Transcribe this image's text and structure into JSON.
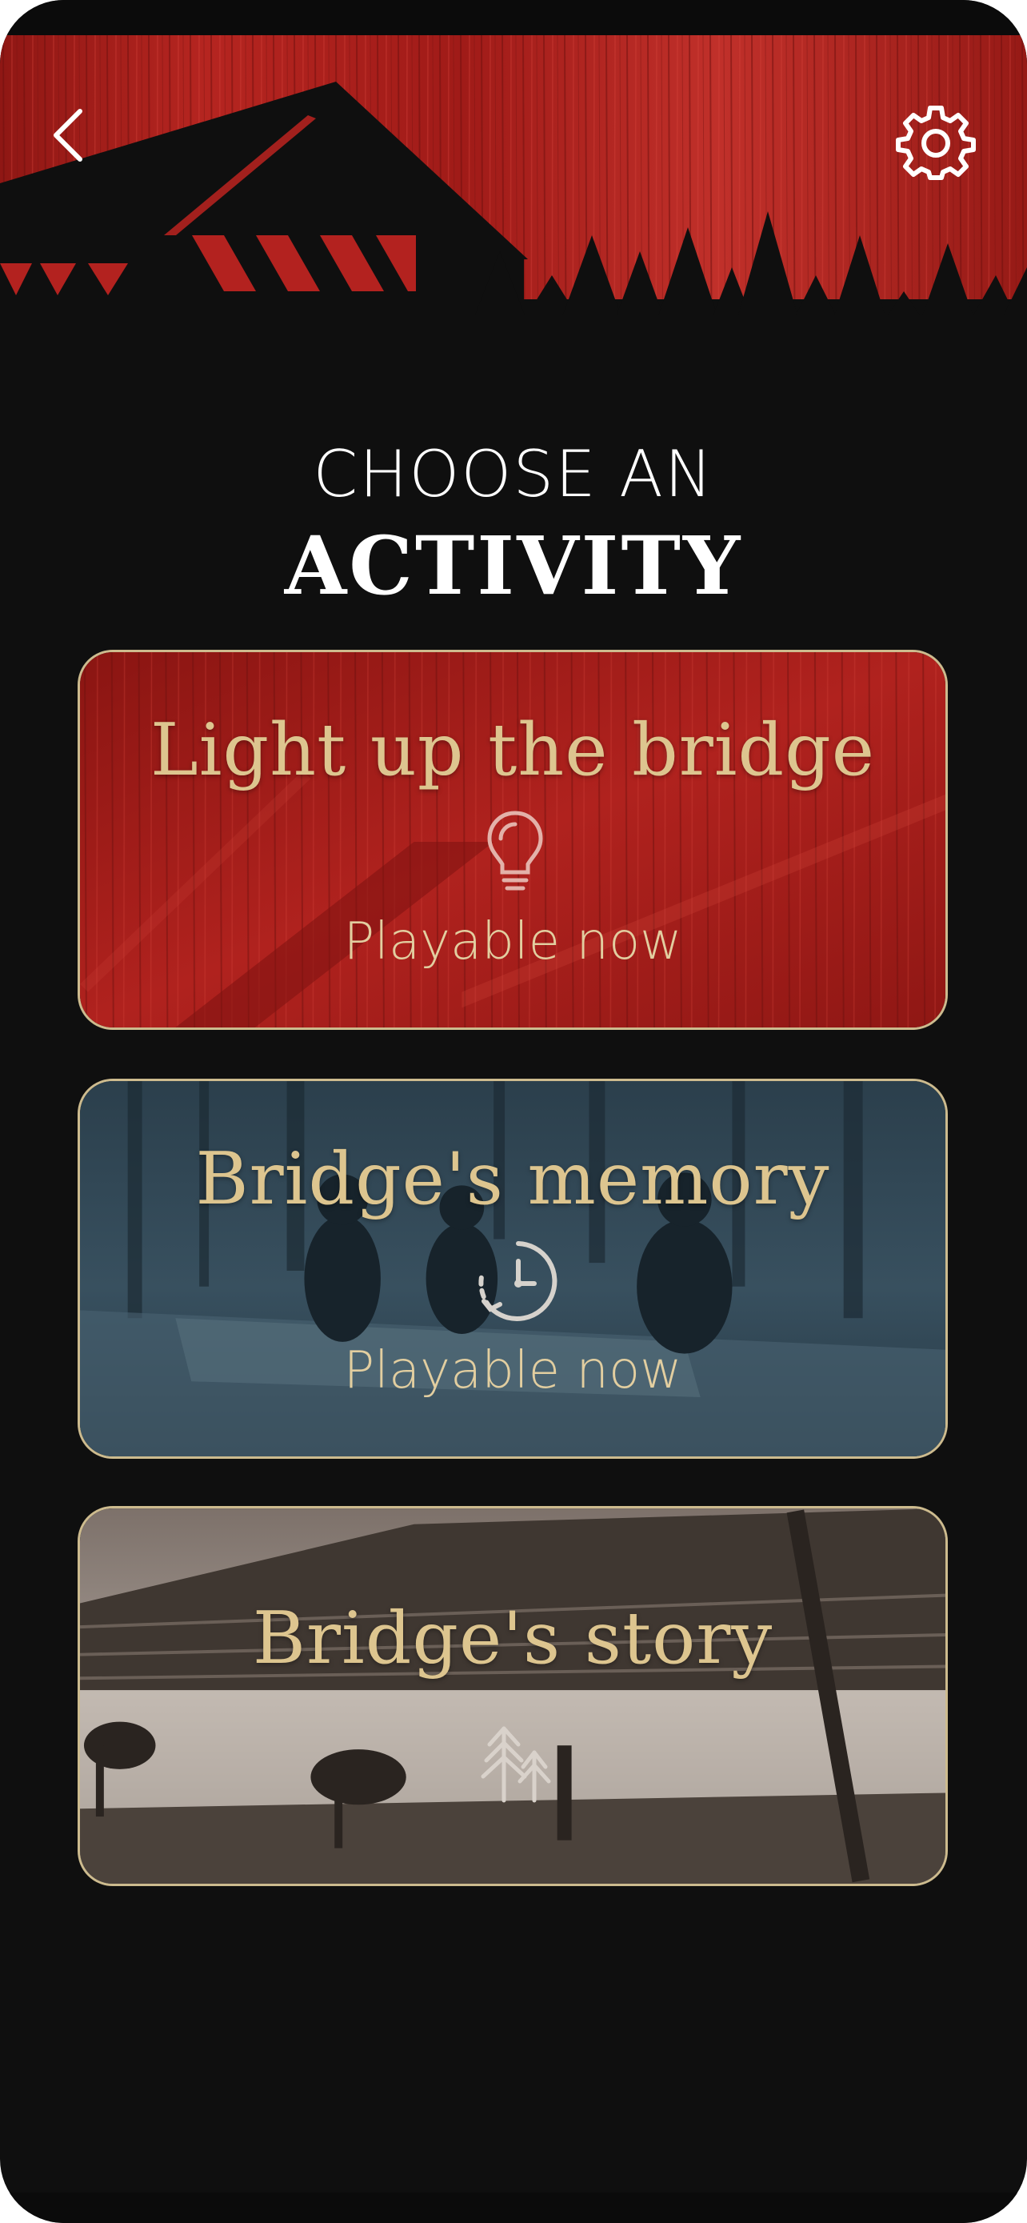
{
  "header": {
    "back_icon": "chevron-left-icon",
    "settings_icon": "gear-icon",
    "hero_image": "covered-bridge-and-pine-trees-silhouette"
  },
  "heading": {
    "line1": "CHOOSE AN",
    "line2": "ACTIVITY"
  },
  "activities": [
    {
      "title": "Light up the bridge",
      "icon": "lightbulb-icon",
      "status": "Playable now",
      "accent": "#b3221f"
    },
    {
      "title": "Bridge's memory",
      "icon": "clock-history-icon",
      "status": "Playable now",
      "accent": "#2f4553"
    },
    {
      "title": "Bridge's story",
      "icon": "trees-icon",
      "status": "",
      "accent": "#6b5f56"
    }
  ],
  "colors": {
    "background": "#0f0f0f",
    "card_border": "#cdbb8e",
    "card_title": "#ddc58f",
    "hero_red": "#b3221f"
  }
}
